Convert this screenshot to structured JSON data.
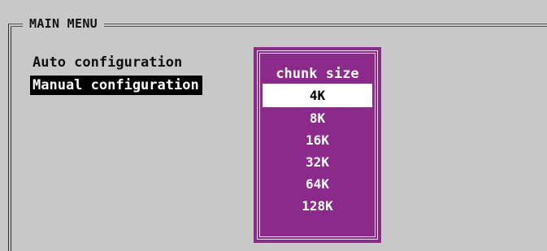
{
  "main_menu": {
    "title": "MAIN MENU",
    "items": [
      {
        "label": "Auto configuration",
        "selected": false
      },
      {
        "label": "Manual configuration",
        "selected": true
      }
    ]
  },
  "chunk_popup": {
    "title": "chunk size",
    "options": [
      "4K",
      "8K",
      "16K",
      "32K",
      "64K",
      "128K"
    ],
    "selected_index": 0,
    "colors": {
      "background": "#8b2a8b",
      "text": "#ffffff",
      "highlight": "#ffffff"
    }
  },
  "colors": {
    "screen_background": "#c8c8c8",
    "menu_highlight": "#000000"
  }
}
